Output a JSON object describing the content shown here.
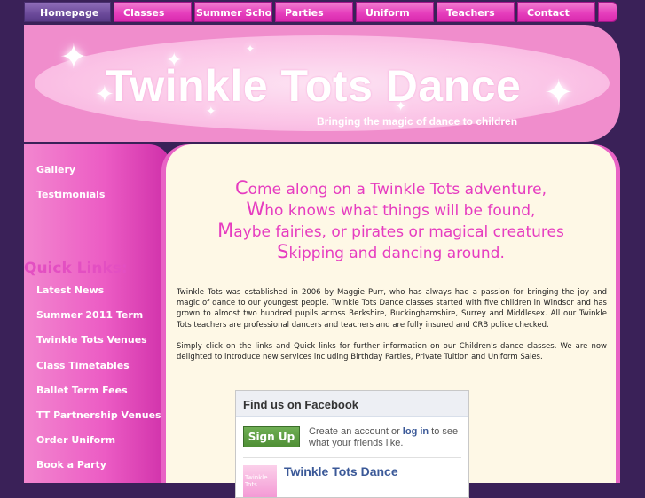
{
  "nav": {
    "items": [
      {
        "label": "Homepage"
      },
      {
        "label": "Classes"
      },
      {
        "label": "Summer School"
      },
      {
        "label": "Parties"
      },
      {
        "label": "Uniform"
      },
      {
        "label": "Teachers"
      },
      {
        "label": "Contact"
      }
    ]
  },
  "banner": {
    "title": "Twinkle Tots Dance",
    "tagline": "Bringing the magic of dance to children"
  },
  "sidebar": {
    "links": [
      {
        "label": "Gallery"
      },
      {
        "label": "Testimonials"
      }
    ],
    "quick_links_title": "Quick Links:",
    "quick_links": [
      {
        "label": "Latest News"
      },
      {
        "label": "Summer 2011 Term"
      },
      {
        "label": "Twinkle Tots Venues"
      },
      {
        "label": "Class Timetables"
      },
      {
        "label": "Ballet Term Fees"
      },
      {
        "label": "TT Partnership Venues"
      },
      {
        "label": "Order Uniform"
      },
      {
        "label": "Book a Party"
      }
    ]
  },
  "main": {
    "poem": [
      {
        "cap": "C",
        "rest": "ome along on a Twinkle Tots adventure,"
      },
      {
        "cap": "W",
        "rest": "ho knows what things will be found,"
      },
      {
        "cap": "M",
        "rest": "aybe fairies, or pirates or magical creatures"
      },
      {
        "cap": "S",
        "rest": "kipping and dancing around."
      }
    ],
    "paragraphs": [
      "Twinkle Tots was established in 2006 by Maggie Purr, who has always had a passion for bringing the joy and magic of dance to our youngest people. Twinkle Tots Dance classes started with five children in Windsor and has grown to almost two hundred pupils across Berkshire, Buckinghamshire, Surrey and Middlesex. All our Twinkle Tots teachers are professional dancers and teachers and are fully insured and CRB police checked.",
      "Simply click on the links and Quick links for further information on our Children's dance classes. We are now delighted to introduce new services including Birthday Parties, Private Tuition and Uniform Sales."
    ]
  },
  "facebook": {
    "header": "Find us on Facebook",
    "signup_label": "Sign Up",
    "create_prefix": "Create an account or ",
    "login_label": "log in",
    "create_suffix": " to see what your friends like.",
    "page_name": "Twinkle Tots Dance",
    "thumb_text": "Twinkle Tots"
  },
  "colors": {
    "background": "#3a2158",
    "nav_pink": "#e63fbd",
    "nav_active": "#6b4a9a",
    "banner_pink": "#f08dcc",
    "poem_pink": "#e63cc0",
    "content_cream": "#fef8e6",
    "facebook_blue": "#3b5998"
  }
}
